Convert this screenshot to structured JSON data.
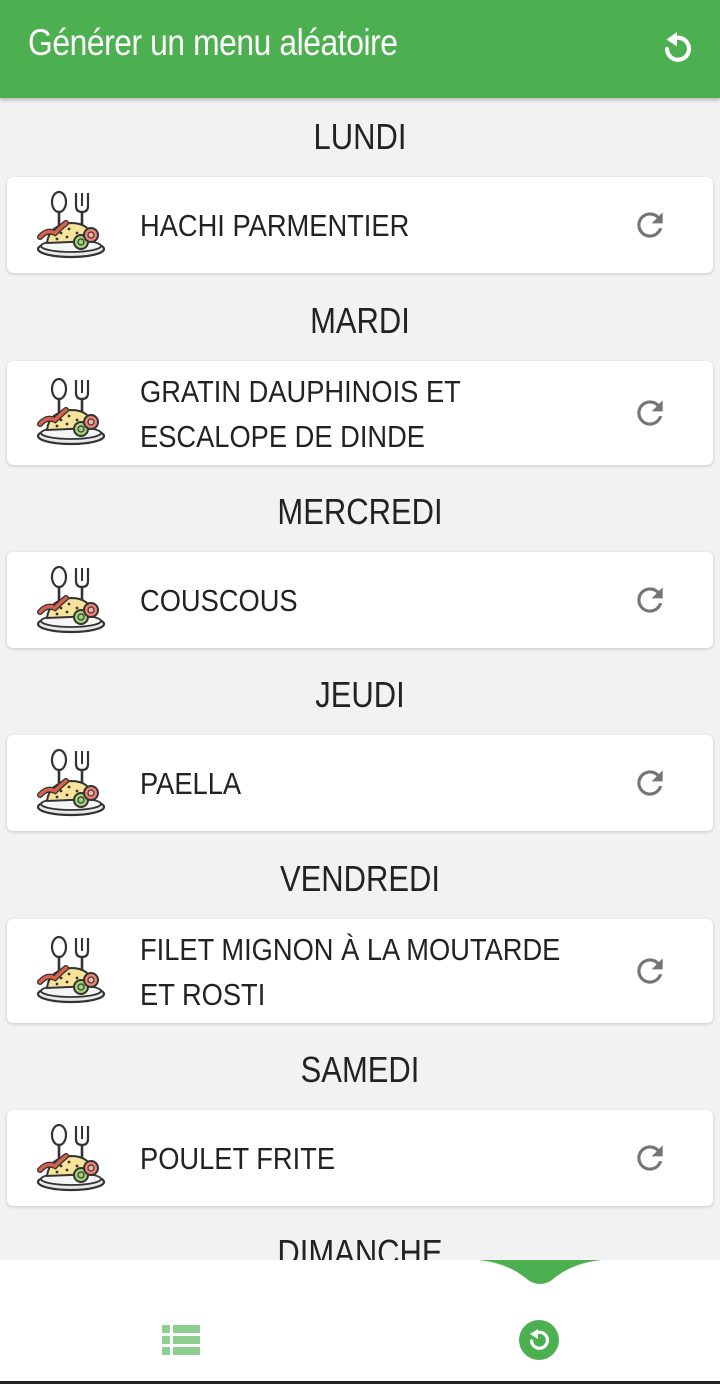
{
  "app_bar": {
    "title": "Générer un menu aléatoire",
    "action_icon": "reset-icon",
    "background_color": "#4caf50"
  },
  "days": [
    {
      "label": "LUNDI",
      "dish": "HACHI PARMENTIER"
    },
    {
      "label": "MARDI",
      "dish": "GRATIN DAUPHINOIS ET ESCALOPE DE DINDE"
    },
    {
      "label": "MERCREDI",
      "dish": "COUSCOUS"
    },
    {
      "label": "JEUDI",
      "dish": "PAELLA"
    },
    {
      "label": "VENDREDI",
      "dish": "FILET MIGNON À LA MOUTARDE ET ROSTI"
    },
    {
      "label": "SAMEDI",
      "dish": "POULET FRITE"
    },
    {
      "label": "DIMANCHE"
    }
  ],
  "icons": {
    "dish": "plate-with-spoon-fork-icon",
    "refresh": "refresh-icon"
  },
  "bottom_nav": {
    "items": [
      {
        "icon": "list-icon",
        "selected": false
      },
      {
        "icon": "random-menu-icon",
        "selected": true
      }
    ],
    "accent_color": "#4caf50"
  }
}
